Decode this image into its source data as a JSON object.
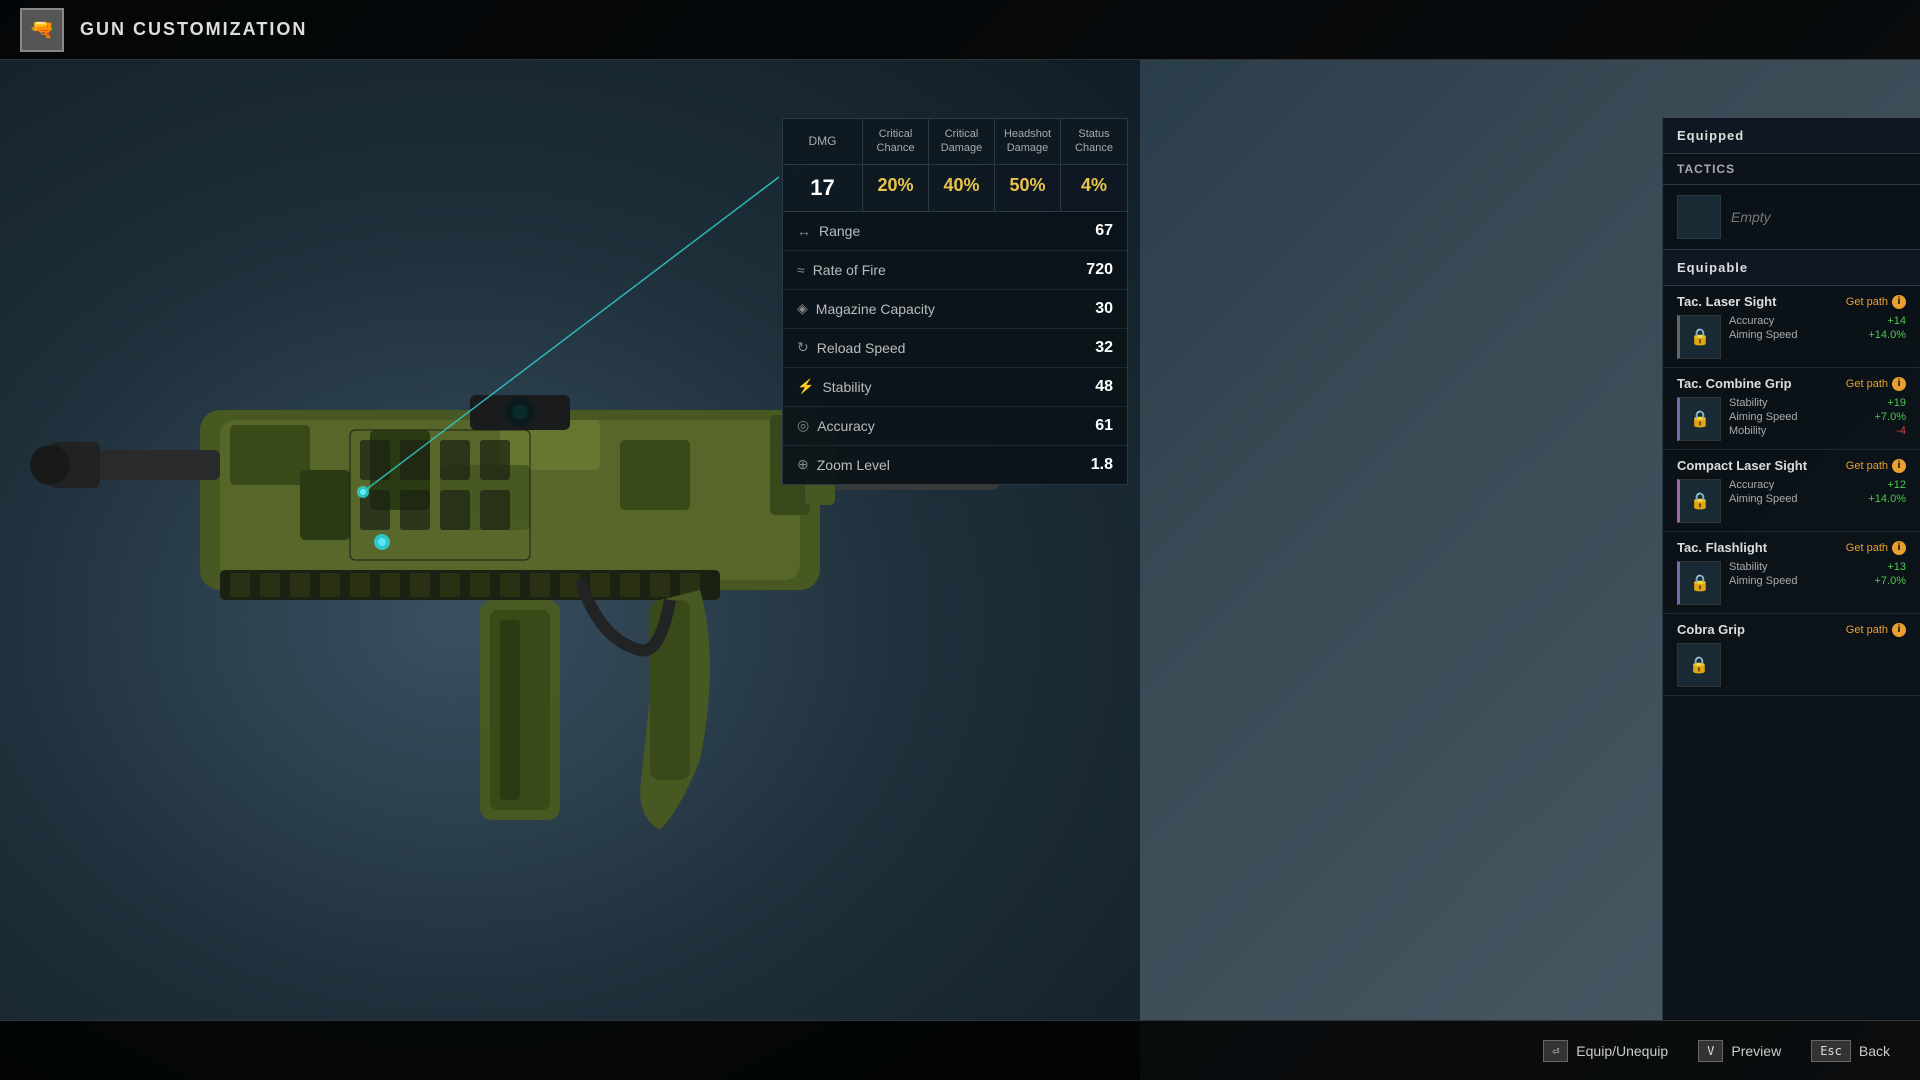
{
  "topbar": {
    "icon_text": "🔫",
    "title": "GUN CUSTOMIZATION"
  },
  "stats_header": {
    "dmg": "DMG",
    "critical_chance": "Critical Chance",
    "critical_damage": "Critical Damage",
    "headshot_damage": "Headshot Damage",
    "status_chance": "Status Chance"
  },
  "stats_values": {
    "dmg": "17",
    "critical_chance": "20%",
    "critical_damage": "40%",
    "headshot_damage": "50%",
    "status_chance": "4%"
  },
  "weapon_stats": [
    {
      "icon": "↔",
      "label": "Range",
      "value": "67"
    },
    {
      "icon": "≈",
      "label": "Rate of Fire",
      "value": "720"
    },
    {
      "icon": "◈",
      "label": "Magazine Capacity",
      "value": "30"
    },
    {
      "icon": "↻",
      "label": "Reload Speed",
      "value": "32"
    },
    {
      "icon": "⚡",
      "label": "Stability",
      "value": "48"
    },
    {
      "icon": "◎",
      "label": "Accuracy",
      "value": "61"
    },
    {
      "icon": "⊕",
      "label": "Zoom Level",
      "value": "1.8"
    }
  ],
  "right_panel": {
    "equipped_title": "Equipped",
    "tactics_title": "TACTICS",
    "equipped_slot_label": "Empty",
    "equipable_title": "Equipable",
    "items": [
      {
        "name": "Tac. Laser Sight",
        "getpath": "Get path",
        "stats": [
          {
            "label": "Accuracy",
            "value": "+14",
            "positive": true
          },
          {
            "label": "Aiming Speed",
            "value": "+14.0%",
            "positive": true
          }
        ]
      },
      {
        "name": "Tac. Combine Grip",
        "getpath": "Get path",
        "stats": [
          {
            "label": "Stability",
            "value": "+19",
            "positive": true
          },
          {
            "label": "Aiming Speed",
            "value": "+7.0%",
            "positive": true
          },
          {
            "label": "Mobility",
            "value": "-4",
            "positive": false
          }
        ]
      },
      {
        "name": "Compact Laser Sight",
        "getpath": "Get path",
        "stats": [
          {
            "label": "Accuracy",
            "value": "+12",
            "positive": true
          },
          {
            "label": "Aiming Speed",
            "value": "+14.0%",
            "positive": true
          }
        ]
      },
      {
        "name": "Tac. Flashlight",
        "getpath": "Get path",
        "stats": [
          {
            "label": "Stability",
            "value": "+13",
            "positive": true
          },
          {
            "label": "Aiming Speed",
            "value": "+7.0%",
            "positive": true
          }
        ]
      },
      {
        "name": "Cobra Grip",
        "getpath": "Get path",
        "stats": []
      }
    ]
  },
  "bottom_bar": {
    "equip_key": "⏎",
    "equip_label": "Equip/Unequip",
    "preview_key": "V",
    "preview_label": "Preview",
    "back_key": "Esc",
    "back_label": "Back"
  }
}
